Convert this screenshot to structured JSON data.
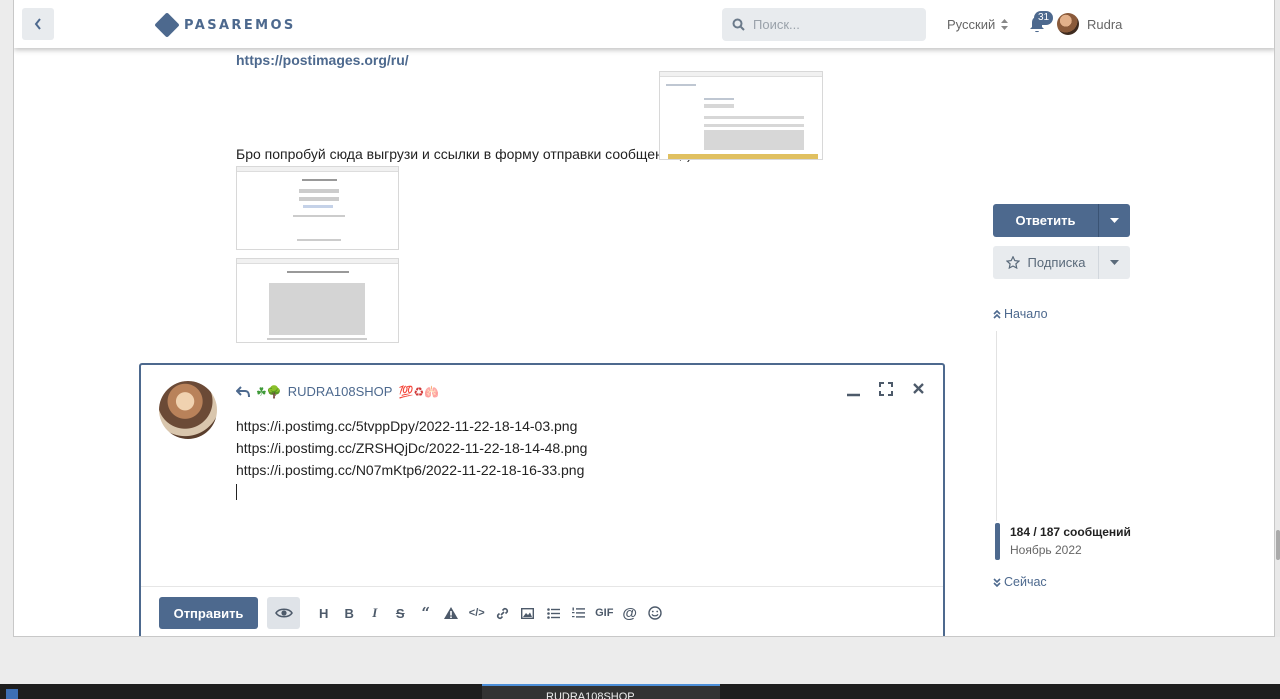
{
  "header": {
    "logo_text": "PASAREMOS",
    "search_placeholder": "Поиск...",
    "language": "Русский",
    "notification_count": "31",
    "username": "Rudra"
  },
  "post": {
    "link_text": "https://postimages.org/ru/",
    "body_text": "Бро попробуй сюда выгрузи и ссылки в форму отправки сообщений;-)!"
  },
  "composer": {
    "reply_to": "RUDRA108SHOP",
    "prefix_emoji": "☘🌳",
    "suffix_emoji": "💯♻🫁",
    "lines": [
      "https://i.postimg.cc/5tvppDpy/2022-11-22-18-14-03.png",
      "https://i.postimg.cc/ZRSHQjDc/2022-11-22-18-14-48.png",
      "https://i.postimg.cc/N07mKtp6/2022-11-22-18-16-33.png"
    ],
    "submit_label": "Отправить",
    "toolbar": [
      "heading",
      "bold",
      "italic",
      "strikethrough",
      "quote",
      "spoiler",
      "code",
      "link",
      "image",
      "bullet-list",
      "numbered-list",
      "gif",
      "mention",
      "emoji"
    ]
  },
  "sidebar": {
    "reply_label": "Ответить",
    "subscribe_label": "Подписка"
  },
  "timeline": {
    "start_label": "Начало",
    "count_text": "184 / 187 сообщений",
    "date_text": "Ноябрь 2022",
    "now_label": "Сейчас",
    "position": 0.98
  },
  "taskbar": {
    "active_title": "RUDRA108SHOP"
  },
  "colors": {
    "accent": "#4d698e",
    "button_light": "#e8ebee"
  }
}
